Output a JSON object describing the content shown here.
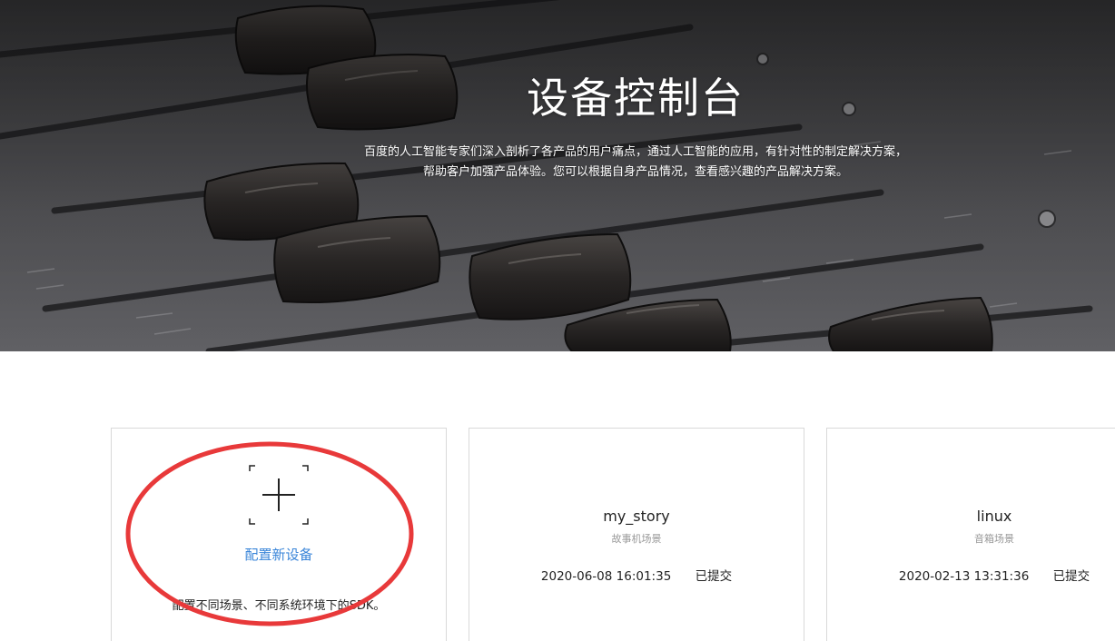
{
  "hero": {
    "title": "设备控制台",
    "description_line1": "百度的人工智能专家们深入剖析了各产品的用户痛点，通过人工智能的应用，有针对性的制定解决方案，",
    "description_line2": "帮助客户加强产品体验。您可以根据自身产品情况，查看感兴趣的产品解决方案。"
  },
  "add_card": {
    "icon": "plus-icon",
    "link_label": "配置新设备",
    "description": "配置不同场景、不同系统环境下的SDK。"
  },
  "devices": [
    {
      "name": "my_story",
      "scene": "故事机场景",
      "time": "2020-06-08 16:01:35",
      "status": "已提交"
    },
    {
      "name": "linux",
      "scene": "音箱场景",
      "time": "2020-02-13 13:31:36",
      "status": "已提交"
    }
  ],
  "colors": {
    "link": "#3b86d9",
    "annotation": "#e8393a",
    "border": "#d9d9d9"
  }
}
